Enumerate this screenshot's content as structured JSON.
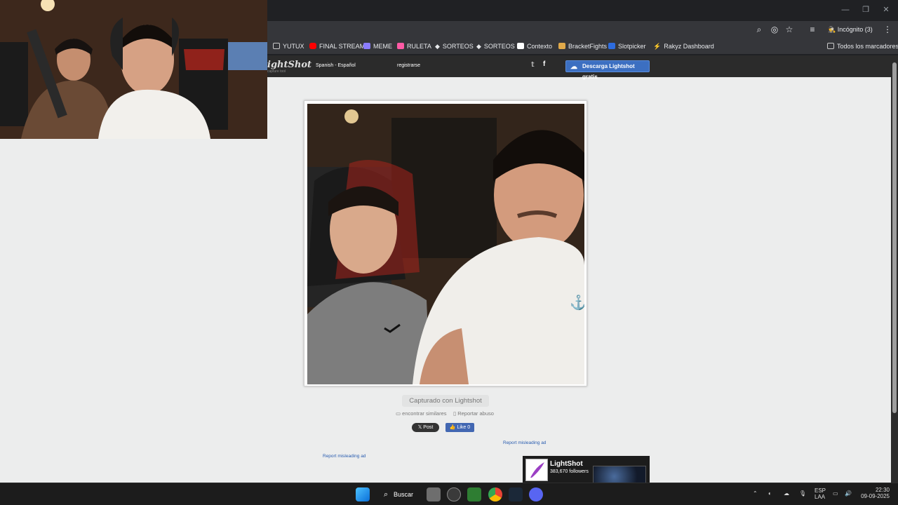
{
  "toolbar": {
    "incognito_label": "Incógnito (3)"
  },
  "bookmarks": {
    "items": [
      {
        "label": "YUTUX",
        "icon": "folder-icon",
        "color": "#c9c9c9"
      },
      {
        "label": "FINAL STREAM",
        "icon": "youtube-icon",
        "color": "#ff0000"
      },
      {
        "label": "MEME",
        "icon": "memes-icon",
        "color": "#8a7cff"
      },
      {
        "label": "RULETA",
        "icon": "roulette-icon",
        "color": "#ff5aa5"
      },
      {
        "label": "SORTEOS",
        "icon": "diamond-icon",
        "color": "#e8eaed"
      },
      {
        "label": "SORTEOS",
        "icon": "diamond-icon",
        "color": "#e8eaed"
      },
      {
        "label": "Contexto",
        "icon": "contexto-icon",
        "color": "#ffffff"
      },
      {
        "label": "BracketFights",
        "icon": "trophy-icon",
        "color": "#e0a94a"
      },
      {
        "label": "Slotpicker",
        "icon": "sp-icon",
        "color": "#2d6cdf"
      },
      {
        "label": "Rakyz Dashboard",
        "icon": "bolt-icon",
        "color": "#f2c94c"
      }
    ],
    "all_bookmarks": "Todos los marcadores"
  },
  "site": {
    "logo": "ightShot",
    "logo_sub": "capture tool",
    "language": "Spanish - Español",
    "register": "registrarse",
    "download_button": "Descarga Lightshot gratis",
    "captured_label": "Capturado con Lightshot",
    "find_similar": "encontrar similares",
    "report_abuse": "Reportar abuso",
    "post_button": "Post",
    "like_button": "Like 0",
    "report_ad_1": "Report misleading ad",
    "report_ad_2": "Report misleading ad",
    "fb_widget": {
      "name": "LightShot",
      "followers": "383,670 followers"
    }
  },
  "taskbar": {
    "search_label": "Buscar",
    "lang_top": "ESP",
    "lang_bottom": "LAA",
    "time": "22:30",
    "date": "09-09-2025"
  }
}
